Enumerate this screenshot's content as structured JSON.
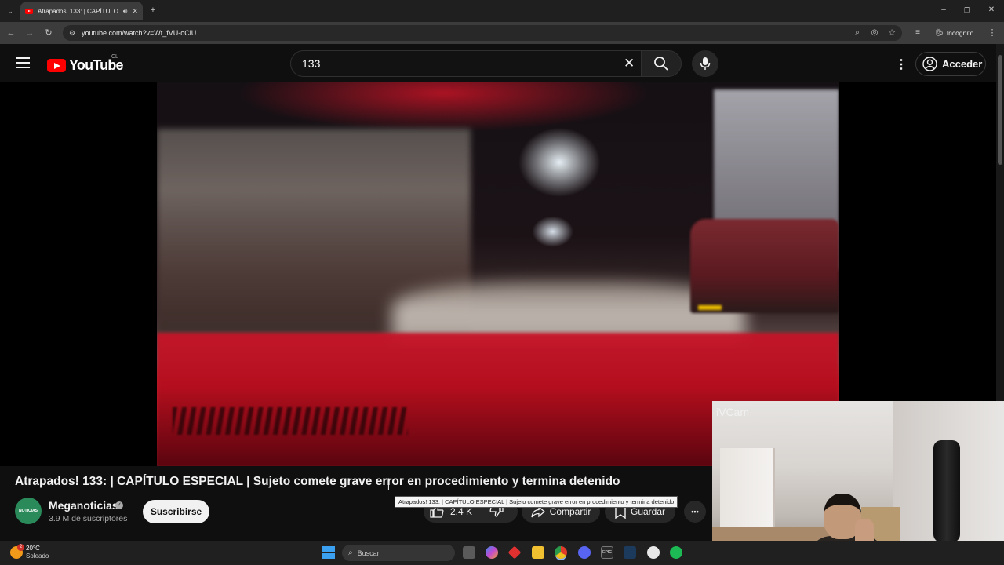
{
  "browser": {
    "tab_title": "Atrapados! 133: | CAPÍTULO ESPECIAL",
    "url": "youtube.com/watch?v=Wt_fVU-oCiU",
    "profile_label": "Incógnito",
    "new_tab": "+",
    "window_minimize": "–",
    "window_restore": "❐",
    "window_close": "✕"
  },
  "masthead": {
    "logo_text": "YouTube",
    "country_code": "CL",
    "search_value": "133",
    "clear_symbol": "✕",
    "signin_label": "Acceder"
  },
  "video": {
    "title": "Atrapados! 133: | CAPÍTULO ESPECIAL | Sujeto comete grave error en procedimiento y termina detenido",
    "tooltip": "Atrapados! 133: | CAPÍTULO ESPECIAL | Sujeto comete grave error en procedimiento y termina detenido"
  },
  "channel": {
    "name": "Meganoticias",
    "avatar_text": "NOTICIAS",
    "subscribers": "3.9 M de suscriptores",
    "subscribe_label": "Suscribirse"
  },
  "actions": {
    "like_count": "2.4 K",
    "share_label": "Compartir",
    "save_label": "Guardar",
    "more_symbol": "•••"
  },
  "webcam": {
    "label": "iVCam"
  },
  "taskbar": {
    "weather_temp": "20°C",
    "weather_desc": "Soleado",
    "weather_badge": "2",
    "search_placeholder": "Buscar"
  },
  "colors": {
    "youtube_red": "#ff0000",
    "background": "#0f0f0f"
  }
}
